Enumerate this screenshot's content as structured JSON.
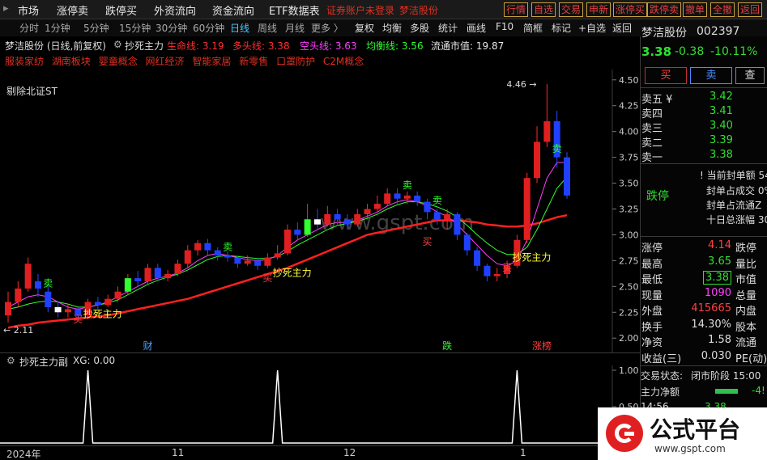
{
  "menu": [
    "市场",
    "涨停卖",
    "跌停买",
    "外资流向",
    "资金流向",
    "ETF数据表"
  ],
  "login_warning": "证券账户未登录",
  "stock_name_top": "梦洁股份",
  "top_buttons": [
    "行情",
    "自选",
    "交易",
    "申新",
    "涨停买",
    "跌停卖",
    "撤单",
    "全撤",
    "返回"
  ],
  "periods": [
    "分时",
    "1分钟",
    "5分钟",
    "15分钟",
    "30分钟",
    "60分钟",
    "日线",
    "周线",
    "月线",
    "更多 〉"
  ],
  "tools": [
    "复权",
    "均衡",
    "多股",
    "统计",
    "画线",
    "F10",
    "简框",
    "标记",
    "+自选",
    "返回"
  ],
  "chart_header": {
    "title": "梦洁股份 (日线,前复权)",
    "indicator": "抄死主力",
    "items": [
      {
        "label": "生命线: 3.19",
        "color": "#ff3030"
      },
      {
        "label": "多头线: 3.38",
        "color": "#ff3030"
      },
      {
        "label": "空头线: 3.63",
        "color": "#ff40ff"
      },
      {
        "label": "均衡线: 3.56",
        "color": "#30ff30"
      },
      {
        "label": "流通市值: 19.87",
        "color": "#e8e8e8"
      }
    ],
    "concepts": [
      "服装家纺",
      "湖南板块",
      "婴童概念",
      "网红经济",
      "智能家居",
      "新零售",
      "口罩防护",
      "C2M概念"
    ],
    "exclude_label": "剔除北证ST"
  },
  "chart_data": {
    "type": "candlestick",
    "ylim": [
      1.9,
      4.6
    ],
    "y_ticks": [
      "4.50",
      "4.25",
      "4.00",
      "3.75",
      "3.50",
      "3.25",
      "3.00",
      "2.75",
      "2.50",
      "2.25",
      "2.00"
    ],
    "max_label": "4.46",
    "min_label": "2.11",
    "annotations": [
      {
        "text": "卖",
        "color": "#30ff30",
        "idx": 4,
        "price": 2.5
      },
      {
        "text": "抄死主力",
        "color": "#ffff40",
        "idx": 8,
        "price": 2.2
      },
      {
        "text": "买",
        "color": "#ff4040",
        "idx": 7,
        "price": 2.15
      },
      {
        "text": "卖",
        "color": "#30ff30",
        "idx": 22,
        "price": 2.85
      },
      {
        "text": "抄死主力",
        "color": "#ffff40",
        "idx": 27,
        "price": 2.6
      },
      {
        "text": "买",
        "color": "#ff4040",
        "idx": 26,
        "price": 2.55
      },
      {
        "text": "卖",
        "color": "#30ff30",
        "idx": 40,
        "price": 3.45
      },
      {
        "text": "卖",
        "color": "#30ff30",
        "idx": 43,
        "price": 3.3
      },
      {
        "text": "买",
        "color": "#ff4040",
        "idx": 42,
        "price": 2.9
      },
      {
        "text": "抄死主力",
        "color": "#ffff40",
        "idx": 51,
        "price": 2.75
      },
      {
        "text": "买",
        "color": "#ff4040",
        "idx": 50,
        "price": 2.65
      },
      {
        "text": "卖",
        "color": "#30ff30",
        "idx": 55,
        "price": 3.8
      }
    ],
    "bottom_markers": [
      {
        "text": "财",
        "idx": 14,
        "color": "#4aa0ff"
      },
      {
        "text": "跌",
        "idx": 44,
        "color": "#30ff30"
      },
      {
        "text": "涨榜",
        "idx": 53,
        "color": "#ff4040"
      }
    ],
    "candles": [
      [
        2.22,
        2.35,
        2.45,
        2.15
      ],
      [
        2.35,
        2.48,
        2.55,
        2.3
      ],
      [
        2.48,
        2.72,
        2.78,
        2.45
      ],
      [
        2.55,
        2.48,
        2.62,
        2.4
      ],
      [
        2.45,
        2.3,
        2.5,
        2.25
      ],
      [
        2.3,
        2.25,
        2.35,
        2.2
      ],
      [
        2.25,
        2.28,
        2.33,
        2.2
      ],
      [
        2.28,
        2.22,
        2.3,
        2.18
      ],
      [
        2.22,
        2.35,
        2.38,
        2.2
      ],
      [
        2.35,
        2.32,
        2.4,
        2.28
      ],
      [
        2.32,
        2.38,
        2.42,
        2.3
      ],
      [
        2.38,
        2.45,
        2.5,
        2.35
      ],
      [
        2.45,
        2.58,
        2.62,
        2.42
      ],
      [
        2.58,
        2.55,
        2.65,
        2.5
      ],
      [
        2.55,
        2.68,
        2.72,
        2.52
      ],
      [
        2.68,
        2.58,
        2.72,
        2.55
      ],
      [
        2.58,
        2.62,
        2.66,
        2.55
      ],
      [
        2.62,
        2.72,
        2.76,
        2.6
      ],
      [
        2.72,
        2.85,
        2.9,
        2.68
      ],
      [
        2.85,
        2.92,
        2.95,
        2.8
      ],
      [
        2.92,
        2.85,
        2.96,
        2.8
      ],
      [
        2.85,
        2.8,
        2.88,
        2.75
      ],
      [
        2.8,
        2.78,
        2.84,
        2.74
      ],
      [
        2.78,
        2.72,
        2.8,
        2.68
      ],
      [
        2.72,
        2.75,
        2.8,
        2.7
      ],
      [
        2.75,
        2.7,
        2.78,
        2.66
      ],
      [
        2.7,
        2.78,
        2.82,
        2.68
      ],
      [
        2.78,
        2.82,
        2.9,
        2.76
      ],
      [
        2.82,
        3.05,
        3.1,
        2.8
      ],
      [
        3.05,
        3.0,
        3.12,
        2.95
      ],
      [
        3.0,
        3.15,
        3.3,
        2.98
      ],
      [
        3.15,
        3.1,
        3.25,
        3.05
      ],
      [
        3.1,
        3.2,
        3.28,
        3.08
      ],
      [
        3.2,
        3.15,
        3.25,
        3.1
      ],
      [
        3.15,
        3.1,
        3.2,
        3.05
      ],
      [
        3.1,
        3.2,
        3.25,
        3.08
      ],
      [
        3.2,
        3.25,
        3.3,
        3.15
      ],
      [
        3.25,
        3.3,
        3.38,
        3.22
      ],
      [
        3.3,
        3.4,
        3.45,
        3.28
      ],
      [
        3.4,
        3.35,
        3.45,
        3.3
      ],
      [
        3.35,
        3.38,
        3.42,
        3.3
      ],
      [
        3.38,
        3.32,
        3.42,
        3.28
      ],
      [
        3.32,
        3.22,
        3.35,
        3.15
      ],
      [
        3.22,
        3.15,
        3.25,
        3.1
      ],
      [
        3.15,
        3.2,
        3.25,
        3.05
      ],
      [
        3.2,
        3.0,
        3.22,
        2.95
      ],
      [
        3.0,
        2.85,
        3.02,
        2.8
      ],
      [
        2.85,
        2.7,
        2.88,
        2.65
      ],
      [
        2.7,
        2.6,
        2.72,
        2.55
      ],
      [
        2.6,
        2.62,
        2.68,
        2.55
      ],
      [
        2.62,
        2.7,
        2.75,
        2.58
      ],
      [
        2.7,
        2.95,
        3.0,
        2.68
      ],
      [
        2.95,
        3.55,
        3.6,
        2.92
      ],
      [
        3.55,
        3.9,
        4.05,
        3.5
      ],
      [
        3.9,
        4.1,
        4.46,
        3.85
      ],
      [
        4.1,
        3.75,
        4.2,
        3.65
      ],
      [
        3.75,
        3.38,
        3.8,
        3.35
      ]
    ],
    "ma_life": [
      2.1,
      2.12,
      2.13,
      2.15,
      2.16,
      2.17,
      2.18,
      2.19,
      2.2,
      2.21,
      2.22,
      2.24,
      2.26,
      2.28,
      2.3,
      2.32,
      2.34,
      2.36,
      2.38,
      2.41,
      2.44,
      2.47,
      2.5,
      2.53,
      2.56,
      2.59,
      2.62,
      2.65,
      2.68,
      2.72,
      2.76,
      2.8,
      2.84,
      2.88,
      2.92,
      2.96,
      3.0,
      3.02,
      3.04,
      3.06,
      3.08,
      3.1,
      3.12,
      3.14,
      3.14,
      3.14,
      3.13,
      3.12,
      3.1,
      3.09,
      3.08,
      3.08,
      3.09,
      3.11,
      3.14,
      3.17,
      3.19
    ],
    "ma_bull": [
      2.3,
      2.35,
      2.4,
      2.42,
      2.4,
      2.35,
      2.3,
      2.28,
      2.3,
      2.32,
      2.35,
      2.4,
      2.45,
      2.5,
      2.55,
      2.58,
      2.6,
      2.63,
      2.68,
      2.75,
      2.8,
      2.82,
      2.8,
      2.78,
      2.76,
      2.75,
      2.76,
      2.8,
      2.88,
      2.95,
      3.0,
      3.05,
      3.1,
      3.12,
      3.12,
      3.14,
      3.18,
      3.22,
      3.28,
      3.32,
      3.34,
      3.32,
      3.28,
      3.22,
      3.18,
      3.1,
      3.0,
      2.9,
      2.8,
      2.72,
      2.7,
      2.75,
      2.95,
      3.25,
      3.55,
      3.7,
      3.7
    ],
    "ma_balance": [
      2.28,
      2.3,
      2.33,
      2.35,
      2.36,
      2.35,
      2.33,
      2.3,
      2.3,
      2.32,
      2.34,
      2.37,
      2.42,
      2.47,
      2.52,
      2.56,
      2.59,
      2.62,
      2.66,
      2.71,
      2.76,
      2.79,
      2.8,
      2.79,
      2.78,
      2.77,
      2.77,
      2.79,
      2.84,
      2.9,
      2.95,
      3.0,
      3.05,
      3.09,
      3.11,
      3.13,
      3.16,
      3.2,
      3.25,
      3.29,
      3.32,
      3.32,
      3.3,
      3.27,
      3.23,
      3.17,
      3.09,
      3.0,
      2.92,
      2.85,
      2.81,
      2.81,
      2.88,
      3.05,
      3.25,
      3.45,
      3.56
    ]
  },
  "sub_chart": {
    "title": "抄死主力副",
    "value": "XG: 0.00",
    "y_ticks": [
      "1.00",
      "0.50",
      "0.00"
    ],
    "spikes": [
      8,
      27,
      51
    ]
  },
  "x_axis": [
    "2024年",
    "11",
    "12",
    "1"
  ],
  "panel": {
    "name": "梦洁股份",
    "code": "002397",
    "price": "3.38",
    "change": "-0.38",
    "pct": "-10.11%",
    "buttons": [
      "买",
      "卖",
      "查"
    ],
    "asks": [
      [
        "卖五 ¥",
        "3.42"
      ],
      [
        "卖四",
        "3.41"
      ],
      [
        "卖三",
        "3.40"
      ],
      [
        "卖二",
        "3.39"
      ],
      [
        "卖一",
        "3.38"
      ]
    ],
    "limit_status": "跌停",
    "limit_rows": [
      "! 当前封单额 54",
      "封单占成交 0%",
      "封单占流通Z",
      "十日总涨幅 30"
    ],
    "stats": [
      [
        "涨停",
        "4.14",
        "跌停",
        ""
      ],
      [
        "最高",
        "3.65",
        "量比",
        ""
      ],
      [
        "最低",
        "3.38",
        "市值",
        ""
      ],
      [
        "现量",
        "1090",
        "总量",
        ""
      ],
      [
        "外盘",
        "415665",
        "内盘",
        ""
      ],
      [
        "换手",
        "14.30%",
        "股本",
        ""
      ],
      [
        "净资",
        "1.58",
        "流通",
        ""
      ],
      [
        "收益(三)",
        "0.030",
        "PE(动)",
        ""
      ]
    ],
    "trade_status_label": "交易状态:",
    "trade_status": "闭市阶段 15:00",
    "main_net_label": "主力净额",
    "main_net_value": "-4!",
    "tick_time": "14:56",
    "tick_price": "3.38"
  },
  "watermark": {
    "brand": "公式平台",
    "url": "www.gspt.com"
  },
  "chart_watermark": "www.gspt.com"
}
